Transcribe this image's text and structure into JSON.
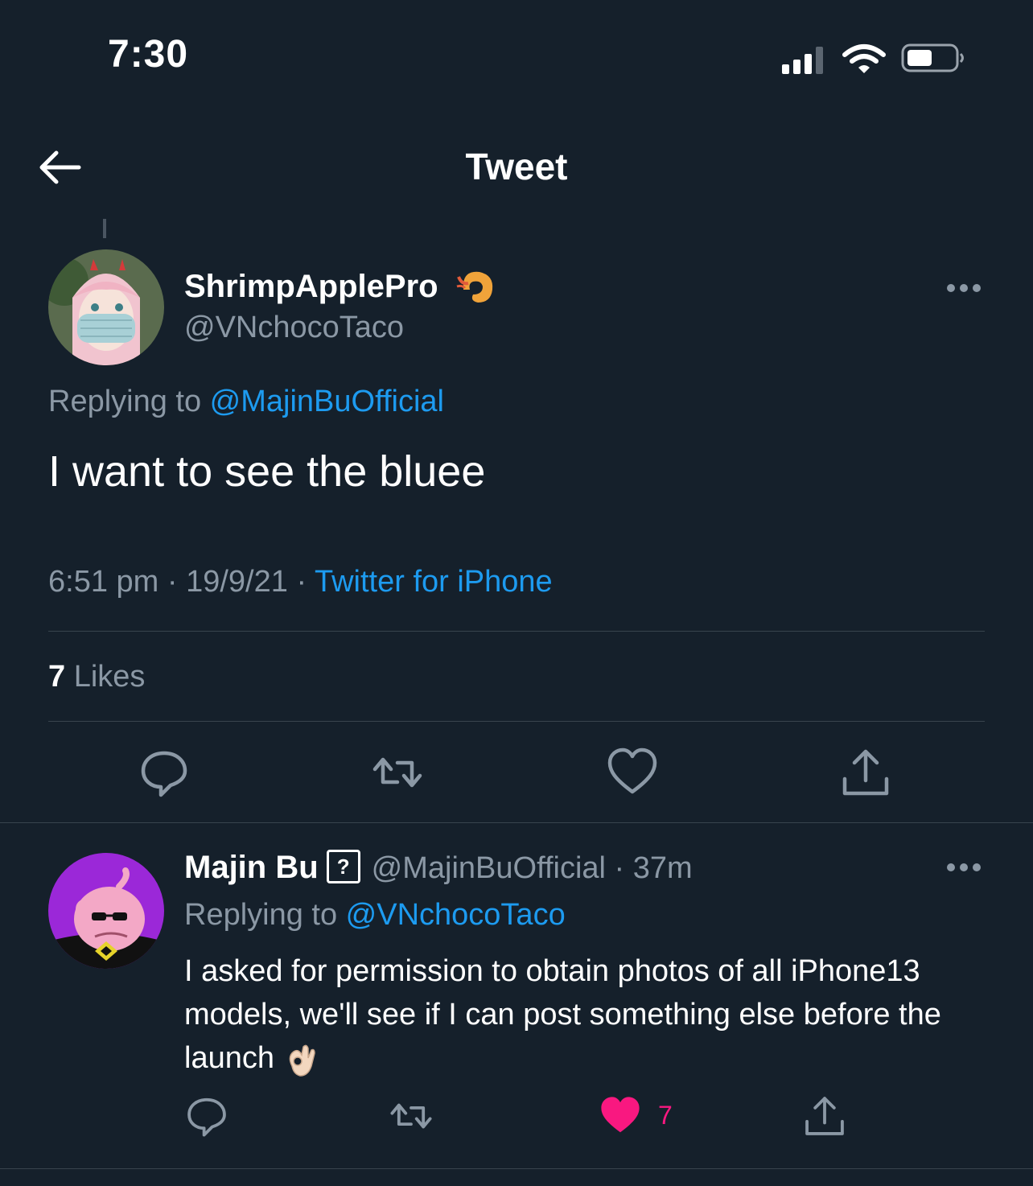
{
  "status_bar": {
    "time": "7:30"
  },
  "header": {
    "title": "Tweet"
  },
  "main_tweet": {
    "display_name": "ShrimpApplePro",
    "handle": "@VNchocoTaco",
    "replying_prefix": "Replying to ",
    "replying_to": "@MajinBuOfficial",
    "text": "I want to see the bluee",
    "time": "6:51 pm",
    "sep1": " · ",
    "date": "19/9/21",
    "sep2": " · ",
    "source": "Twitter for iPhone",
    "likes_count": "7",
    "likes_label": "Likes"
  },
  "reply_tweet": {
    "display_name": "Majin Bu",
    "badge": "?",
    "handle": "@MajinBuOfficial",
    "sep": " · ",
    "age": "37m",
    "replying_prefix": "Replying to ",
    "replying_to": "@VNchocoTaco",
    "text": "I asked for permission to obtain photos of all iPhone13 models, we'll see if I can post something else before the launch",
    "like_count": "7",
    "liked": true
  },
  "colors": {
    "background": "#15202b",
    "link_blue": "#1d9bf0",
    "secondary_text": "#8b98a5",
    "like_pink": "#f91880",
    "divider": "#38444d"
  },
  "icons": [
    "back-arrow-icon",
    "more-icon",
    "reply-icon",
    "retweet-icon",
    "like-icon",
    "share-icon",
    "shrimp-icon",
    "ok-hand-emoji"
  ]
}
